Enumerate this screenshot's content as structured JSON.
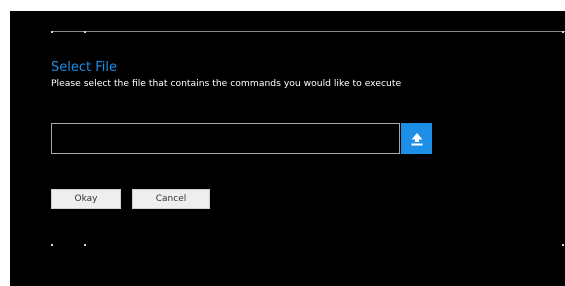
{
  "dialog": {
    "title": "Select File",
    "subtitle": "Please select the file that contains the commands you would like to execute"
  },
  "file_input": {
    "value": "",
    "placeholder": ""
  },
  "upload_button": {
    "icon": "upload-icon"
  },
  "buttons": {
    "okay_label": "Okay",
    "cancel_label": "Cancel"
  },
  "colors": {
    "background": "#000000",
    "accent": "#1e8fe6",
    "text": "#ffffff",
    "button_bg": "#eeeeee"
  }
}
